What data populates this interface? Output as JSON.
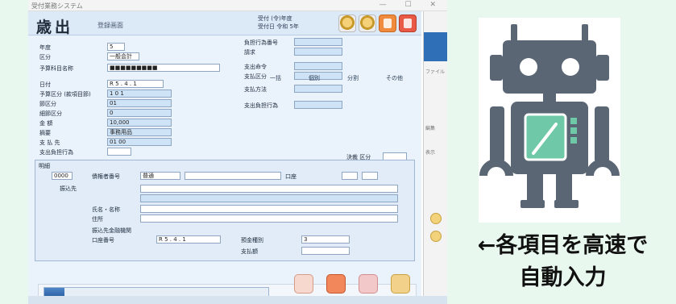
{
  "window": {
    "title": "受付業務システム",
    "controls": "— ☐ ✕"
  },
  "form": {
    "mode_label": "歳出",
    "mode_sub": "登録画面",
    "tool_info_line1": "受付 (令)年度",
    "tool_info_line2": "受付日 令和 5年",
    "fields_left": [
      {
        "label": "年度",
        "value": "5"
      },
      {
        "label": "区分",
        "value": "一般会計"
      },
      {
        "label": "予算科目名称",
        "value": "■■■■■■■■■"
      },
      {
        "label": "日付",
        "value": "R 5 . 4 . 1"
      },
      {
        "label": "予算区分 (款項目節)",
        "value": "1 0 1"
      },
      {
        "label": "節区分",
        "value": "01"
      },
      {
        "label": "細節区分",
        "value": "0"
      },
      {
        "label": "金 額",
        "value": "10,000"
      },
      {
        "label": "摘要",
        "value": "事務用品"
      },
      {
        "label": "支 払 先",
        "value": "01 00"
      },
      {
        "label": "支出負担行為",
        "value": ""
      }
    ],
    "fields_right": [
      {
        "label": "負担行為番号",
        "value": ""
      },
      {
        "label": "請求",
        "value": ""
      },
      {
        "label": "支出命令",
        "value": ""
      },
      {
        "label": "支払区分",
        "value": ""
      },
      {
        "label": "支払方法",
        "value": ""
      },
      {
        "label": "支出負担行為",
        "value": ""
      }
    ],
    "checks": [
      "一括",
      "個別",
      "分割",
      "その他"
    ],
    "small_right_label": "決裁 区分",
    "panel": {
      "title": "明細",
      "labels": [
        "債権者番号",
        "口座",
        "氏名・名称",
        "住所",
        "振込先金融機関",
        "支払額"
      ],
      "sub_labels": [
        "振込先",
        "口座番号",
        "預金種別"
      ],
      "values": [
        "0000",
        "普通",
        "R 5 . 4 . 1",
        "3"
      ]
    },
    "progress_value": 0.09
  },
  "background_window": {
    "labels": [
      "ファイル",
      "編集",
      "表示"
    ]
  },
  "caption": {
    "line1": "←各項目を高速で",
    "line2": "自動入力"
  },
  "colors": {
    "background": "#e9f8ee",
    "robot": "#5b6675",
    "robot_screen": "#6fc9a8"
  },
  "icons": [
    "robot-icon",
    "gear-icon",
    "folder-icon",
    "printer-icon",
    "close-icon"
  ]
}
